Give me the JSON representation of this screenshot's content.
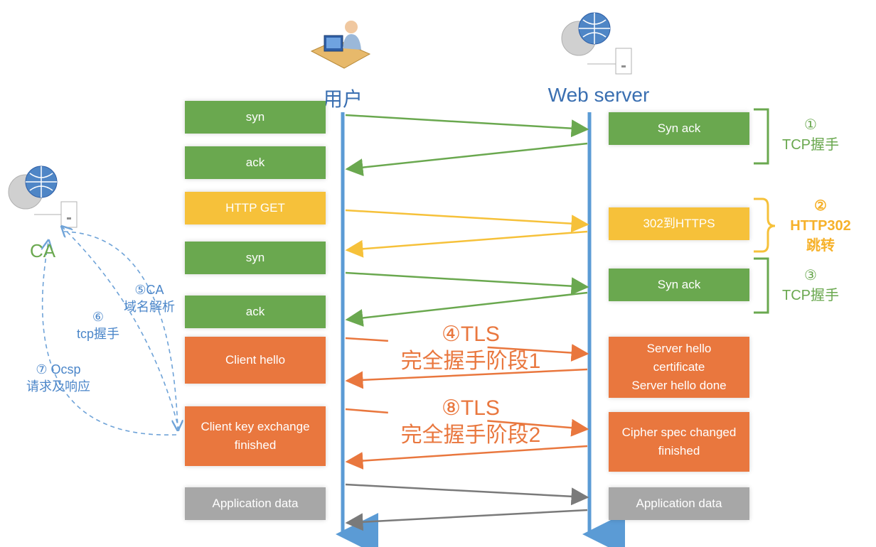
{
  "actors": {
    "client": "用户",
    "server": "Web server",
    "ca": "CA"
  },
  "client_boxes": [
    {
      "text": "syn",
      "color": "green"
    },
    {
      "text": "ack",
      "color": "green"
    },
    {
      "text": "HTTP GET",
      "color": "yellow"
    },
    {
      "text": "syn",
      "color": "green"
    },
    {
      "text": "ack",
      "color": "green"
    },
    {
      "text": "Client hello",
      "color": "orange"
    },
    {
      "text": "Client key exchange\nfinished",
      "color": "orange"
    },
    {
      "text": "Application data",
      "color": "gray"
    }
  ],
  "server_boxes": [
    {
      "text": "Syn ack",
      "color": "green"
    },
    {
      "text": "302到HTTPS",
      "color": "yellow"
    },
    {
      "text": "Syn ack",
      "color": "green"
    },
    {
      "text": "Server hello\ncertificate\nServer hello done",
      "color": "orange"
    },
    {
      "text": "Cipher spec changed\nfinished",
      "color": "orange"
    },
    {
      "text": "Application data",
      "color": "gray"
    }
  ],
  "phases": {
    "p1": "①\nTCP握手",
    "p2": "②\nHTTP302\n跳转",
    "p3": "③\nTCP握手",
    "p4": "④TLS\n完全握手阶段1",
    "p8": "⑧TLS\n完全握手阶段2"
  },
  "ca_notes": {
    "n5": "⑤CA\n域名解析",
    "n6": "⑥\ntcp握手",
    "n7": "⑦ Ocsp\n请求及响应"
  },
  "colors": {
    "green": "#6aa84f",
    "yellow": "#f6c13a",
    "orange": "#e9773e",
    "gray": "#7a7a7a",
    "lifeline": "#5b9bd5",
    "dashed": "#6fa3d8"
  },
  "icons": {
    "client": "user-computer-icon",
    "server": "web-server-icon",
    "ca": "ca-server-icon"
  }
}
